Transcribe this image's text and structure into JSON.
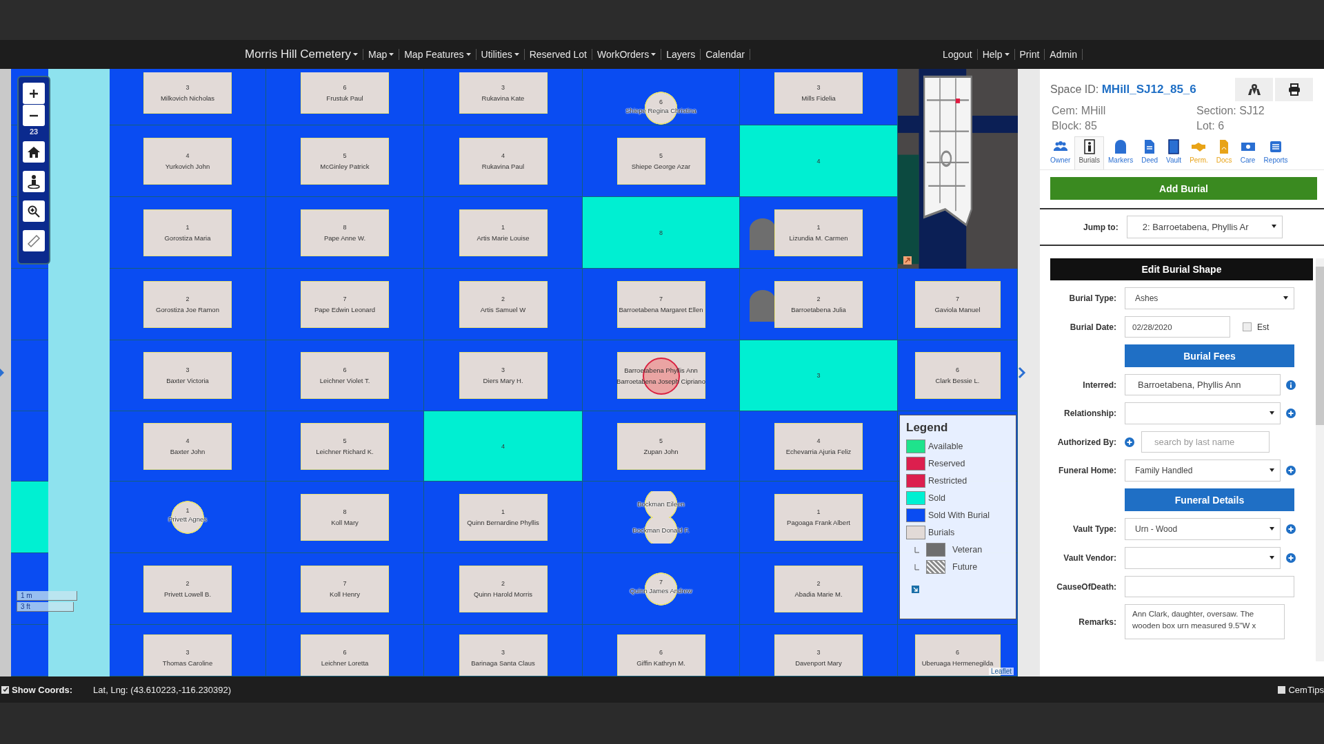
{
  "navbar": {
    "brand": {
      "label": "Morris Hill Cemetery",
      "dropdown": true
    },
    "menu": [
      {
        "label": "Map",
        "dropdown": true
      },
      {
        "label": "Map Features",
        "dropdown": true
      },
      {
        "label": "Utilities",
        "dropdown": true
      },
      {
        "label": "Reserved Lot",
        "dropdown": false
      },
      {
        "label": "WorkOrders",
        "dropdown": true
      },
      {
        "label": "Layers",
        "dropdown": false
      },
      {
        "label": "Calendar",
        "dropdown": false
      }
    ],
    "account_menu": [
      {
        "label": "Logout",
        "dropdown": false
      },
      {
        "label": "Help",
        "dropdown": true
      },
      {
        "label": "Print",
        "dropdown": false
      },
      {
        "label": "Admin",
        "dropdown": false
      }
    ]
  },
  "map": {
    "zoom_level": "23",
    "scale": [
      "1 m",
      "3 ft"
    ],
    "attribution": "Leaflet",
    "edge_column": [
      {
        "kind": "empty"
      },
      {
        "kind": "empty"
      },
      {
        "kind": "empty"
      },
      {
        "kind": "empty"
      },
      {
        "kind": "empty"
      },
      {
        "kind": "empty"
      },
      {
        "kind": "sold"
      },
      {
        "kind": "empty"
      },
      {
        "kind": "empty"
      }
    ],
    "rows": [
      [
        {
          "kind": "plot",
          "number": "3",
          "names": [
            "Milkovich Nicholas"
          ],
          "selected": false
        },
        {
          "kind": "plot",
          "number": "6",
          "names": [
            "Frustuk Paul"
          ],
          "selected": false
        },
        {
          "kind": "plot",
          "number": "3",
          "names": [
            "Rukavina Kate"
          ],
          "selected": false
        },
        {
          "kind": "round",
          "number": "6",
          "names": [
            "Shiepe Regina Christina"
          ]
        },
        {
          "kind": "plot",
          "number": "3",
          "names": [
            "Mills Fidelia"
          ],
          "selected": false
        },
        {
          "kind": "empty"
        }
      ],
      [
        {
          "kind": "plot",
          "number": "4",
          "names": [
            "Yurkovich John"
          ],
          "selected": false
        },
        {
          "kind": "plot",
          "number": "5",
          "names": [
            "McGinley Patrick"
          ],
          "selected": false
        },
        {
          "kind": "plot",
          "number": "4",
          "names": [
            "Rukavina Paul"
          ],
          "selected": false
        },
        {
          "kind": "plot",
          "number": "5",
          "names": [
            "Shiepe George Azar"
          ],
          "selected": false
        },
        {
          "kind": "sold",
          "number": "4"
        },
        {
          "kind": "empty"
        }
      ],
      [
        {
          "kind": "plot",
          "number": "1",
          "names": [
            "Gorostiza Maria"
          ],
          "selected": false
        },
        {
          "kind": "plot",
          "number": "8",
          "names": [
            "Pape Anne W."
          ],
          "selected": false
        },
        {
          "kind": "plot",
          "number": "1",
          "names": [
            "Artis Marie Louise"
          ],
          "selected": false
        },
        {
          "kind": "sold",
          "number": "8"
        },
        {
          "kind": "plot",
          "number": "1",
          "names": [
            "Lizundia M. Carmen"
          ],
          "selected": false,
          "headstone": true
        },
        {
          "kind": "empty"
        }
      ],
      [
        {
          "kind": "plot",
          "number": "2",
          "names": [
            "Gorostiza Joe Ramon"
          ],
          "selected": false
        },
        {
          "kind": "plot",
          "number": "7",
          "names": [
            "Pape Edwin Leonard"
          ],
          "selected": false
        },
        {
          "kind": "plot",
          "number": "2",
          "names": [
            "Artis Samuel W"
          ],
          "selected": false
        },
        {
          "kind": "plot",
          "number": "7",
          "names": [
            "Barroetabena Margaret Ellen"
          ],
          "selected": false
        },
        {
          "kind": "plot",
          "number": "2",
          "names": [
            "Barroetabena Julia"
          ],
          "selected": false,
          "headstone": true
        },
        {
          "kind": "plot",
          "number": "7",
          "names": [
            "Gaviola Manuel"
          ],
          "selected": false
        }
      ],
      [
        {
          "kind": "plot",
          "number": "3",
          "names": [
            "Baxter Victoria"
          ],
          "selected": false
        },
        {
          "kind": "plot",
          "number": "6",
          "names": [
            "Leichner Violet T."
          ],
          "selected": false
        },
        {
          "kind": "plot",
          "number": "3",
          "names": [
            "Diers Mary H."
          ],
          "selected": false
        },
        {
          "kind": "plot",
          "names": [
            "Barroetabena Phyllis Ann",
            "Barroetabena Joseph Cipriano"
          ],
          "selected": true
        },
        {
          "kind": "sold",
          "number": "3"
        },
        {
          "kind": "plot",
          "number": "6",
          "names": [
            "Clark Bessie L."
          ],
          "selected": false
        }
      ],
      [
        {
          "kind": "plot",
          "number": "4",
          "names": [
            "Baxter John"
          ],
          "selected": false
        },
        {
          "kind": "plot",
          "number": "5",
          "names": [
            "Leichner Richard K."
          ],
          "selected": false
        },
        {
          "kind": "sold",
          "number": "4"
        },
        {
          "kind": "plot",
          "number": "5",
          "names": [
            "Zupan John"
          ],
          "selected": false
        },
        {
          "kind": "plot",
          "number": "4",
          "names": [
            "Echevarria Ajuria Feliz"
          ],
          "selected": false
        },
        {
          "kind": "empty"
        }
      ],
      [
        {
          "kind": "round",
          "number": "1",
          "names": [
            "Privett Agnes"
          ]
        },
        {
          "kind": "plot",
          "number": "8",
          "names": [
            "Koll Mary"
          ],
          "selected": false
        },
        {
          "kind": "plot",
          "number": "1",
          "names": [
            "Quinn Bernardine Phyllis"
          ],
          "selected": false
        },
        {
          "kind": "pair",
          "names": [
            "Bockman Eileen",
            "Bockman Donald F."
          ]
        },
        {
          "kind": "plot",
          "number": "1",
          "names": [
            "Pagoaga Frank Albert"
          ],
          "selected": false
        },
        {
          "kind": "empty"
        }
      ],
      [
        {
          "kind": "plot",
          "number": "2",
          "names": [
            "Privett Lowell B."
          ],
          "selected": false
        },
        {
          "kind": "plot",
          "number": "7",
          "names": [
            "Koll Henry"
          ],
          "selected": false
        },
        {
          "kind": "plot",
          "number": "2",
          "names": [
            "Quinn Harold Morris"
          ],
          "selected": false
        },
        {
          "kind": "round",
          "number": "7",
          "names": [
            "Quinn James Andrew"
          ]
        },
        {
          "kind": "plot",
          "number": "2",
          "names": [
            "Abadia Marie M."
          ],
          "selected": false
        },
        {
          "kind": "empty"
        }
      ],
      [
        {
          "kind": "plot",
          "number": "3",
          "names": [
            "Thomas Caroline"
          ],
          "selected": false
        },
        {
          "kind": "plot",
          "number": "6",
          "names": [
            "Leichner Loretta"
          ],
          "selected": false
        },
        {
          "kind": "plot",
          "number": "3",
          "names": [
            "Barinaga Santa Claus"
          ],
          "selected": false
        },
        {
          "kind": "plot",
          "number": "6",
          "names": [
            "Giffin Kathryn M."
          ],
          "selected": false
        },
        {
          "kind": "plot",
          "number": "3",
          "names": [
            "Davenport Mary"
          ],
          "selected": false
        },
        {
          "kind": "plot",
          "number": "6",
          "names": [
            "Uberuaga Hermenegilda"
          ],
          "selected": false
        }
      ]
    ],
    "legend": {
      "title": "Legend",
      "items": [
        {
          "label": "Available",
          "color": "#1ee38c",
          "kind": "fill"
        },
        {
          "label": "Reserved",
          "color": "#dc1f4e",
          "kind": "fill"
        },
        {
          "label": "Restricted",
          "color": "#dc1f4e",
          "kind": "fill"
        },
        {
          "label": "Sold",
          "color": "#00f0d2",
          "kind": "fill"
        },
        {
          "label": "Sold With Burial",
          "color": "#0a4cf2",
          "kind": "fill"
        },
        {
          "label": "Burials",
          "color": "#e2dad7",
          "kind": "fill",
          "children": [
            {
              "label": "Veteran",
              "color": "#6e6e6e",
              "kind": "fill"
            },
            {
              "label": "Future",
              "color": "#8a8a8a",
              "kind": "hatch"
            }
          ]
        }
      ]
    }
  },
  "panel": {
    "space": {
      "label": "Space ID:",
      "id": "MHill_SJ12_85_6"
    },
    "details": [
      "Cem: MHill",
      "Section: SJ12",
      "Block: 85",
      "Lot: 6"
    ],
    "tabs": [
      {
        "label": "Owner",
        "selected": false,
        "color": "#2a6fd2"
      },
      {
        "label": "Burials",
        "selected": true,
        "color": "#555555"
      },
      {
        "label": "Markers",
        "selected": false,
        "color": "#2a6fd2"
      },
      {
        "label": "Deed",
        "selected": false,
        "color": "#2a6fd2"
      },
      {
        "label": "Vault",
        "selected": false,
        "color": "#2a6fd2"
      },
      {
        "label": "Perm.",
        "selected": false,
        "color": "#e8a317"
      },
      {
        "label": "Docs",
        "selected": false,
        "color": "#e8a317"
      },
      {
        "label": "Care",
        "selected": false,
        "color": "#2a6fd2"
      },
      {
        "label": "Reports",
        "selected": false,
        "color": "#2a6fd2"
      }
    ],
    "add_button": "Add Burial",
    "jump_to": {
      "label": "Jump to:",
      "value": "2: Barroetabena, Phyllis Ar"
    },
    "form": {
      "title": "Edit Burial Shape",
      "fields": [
        {
          "kind": "select",
          "label": "Burial Type:",
          "value": "Ashes",
          "add": false
        },
        {
          "kind": "date",
          "label": "Burial Date:",
          "value": "02/28/2020",
          "estimate": {
            "label": "Est",
            "checked": false
          }
        },
        {
          "kind": "button",
          "label": "Burial Fees"
        },
        {
          "kind": "text",
          "label": "Interred:",
          "value": "Barroetabena, Phyllis Ann",
          "info": true
        },
        {
          "kind": "select",
          "label": "Relationship:",
          "add": true
        },
        {
          "kind": "search",
          "label": "Authorized By:",
          "placeholder": "search by last name"
        },
        {
          "kind": "select",
          "label": "Funeral Home:",
          "value": "Family Handled",
          "add": true
        },
        {
          "kind": "button",
          "label": "Funeral Details"
        },
        {
          "kind": "select",
          "label": "Vault Type:",
          "value": "Urn - Wood",
          "add": true
        },
        {
          "kind": "select",
          "label": "Vault Vendor:",
          "add": true
        },
        {
          "kind": "text",
          "label": "CauseOfDeath:",
          "info": false
        },
        {
          "kind": "textarea",
          "label": "Remarks:",
          "value": "Ann Clark, daughter, oversaw. The wooden box urn measured 9.5\"W x"
        }
      ]
    }
  },
  "status_bar": {
    "show_coords": {
      "label": "Show Coords:",
      "checked": true
    },
    "coords": "Lat, Lng: (43.610223,-116.230392)",
    "cemtips": {
      "label": "CemTips",
      "checked": false
    }
  }
}
